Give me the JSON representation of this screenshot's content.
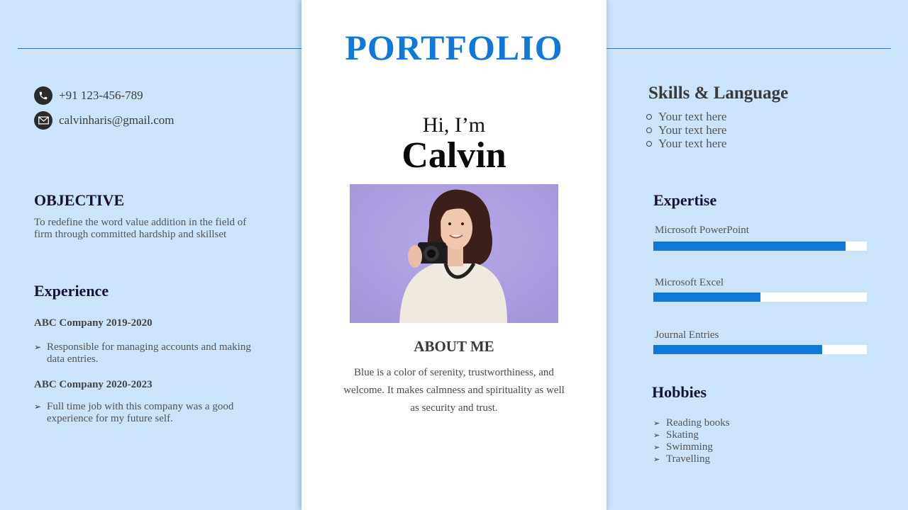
{
  "header": {
    "title": "PORTFOLIO"
  },
  "colors": {
    "accent": "#0f78d8",
    "background": "#cce4fa",
    "panel": "#ffffff",
    "heading": "#1a1033"
  },
  "contact": {
    "phone": {
      "icon": "phone-icon",
      "value": "+91 123-456-789"
    },
    "email": {
      "icon": "mail-icon",
      "value": "calvinharis@gmail.com"
    }
  },
  "objective": {
    "heading": "OBJECTIVE",
    "text": "To redefine the word value addition in the field of firm through committed hardship and skillset"
  },
  "experience": {
    "heading": "Experience",
    "jobs": [
      {
        "title": "ABC Company  2019-2020",
        "bullet": "Responsible for managing accounts and making data entries."
      },
      {
        "title": "ABC Company  2020-2023",
        "bullet": "Full time job with this company was a good experience for my future self."
      }
    ]
  },
  "intro": {
    "greeting": "Hi, I’m",
    "name": "Calvin",
    "photo_alt": "Woman holding a camera on a purple background"
  },
  "about": {
    "heading": "ABOUT ME",
    "text": "Blue is a color of serenity, trustworthiness,  and welcome. It makes calmness and spirituality as well as security and trust."
  },
  "skills": {
    "heading": "Skills & Language",
    "items": [
      "Your text here",
      "Your text here",
      "Your text here"
    ]
  },
  "expertise": {
    "heading": "Expertise",
    "items": [
      {
        "label": "Microsoft PowerPoint",
        "level_percent": 90
      },
      {
        "label": "Microsoft Excel",
        "level_percent": 50
      },
      {
        "label": "Journal Entries",
        "level_percent": 79
      }
    ]
  },
  "hobbies": {
    "heading": "Hobbies",
    "items": [
      "Reading books",
      "Skating",
      "Swimming",
      "Travelling"
    ]
  }
}
